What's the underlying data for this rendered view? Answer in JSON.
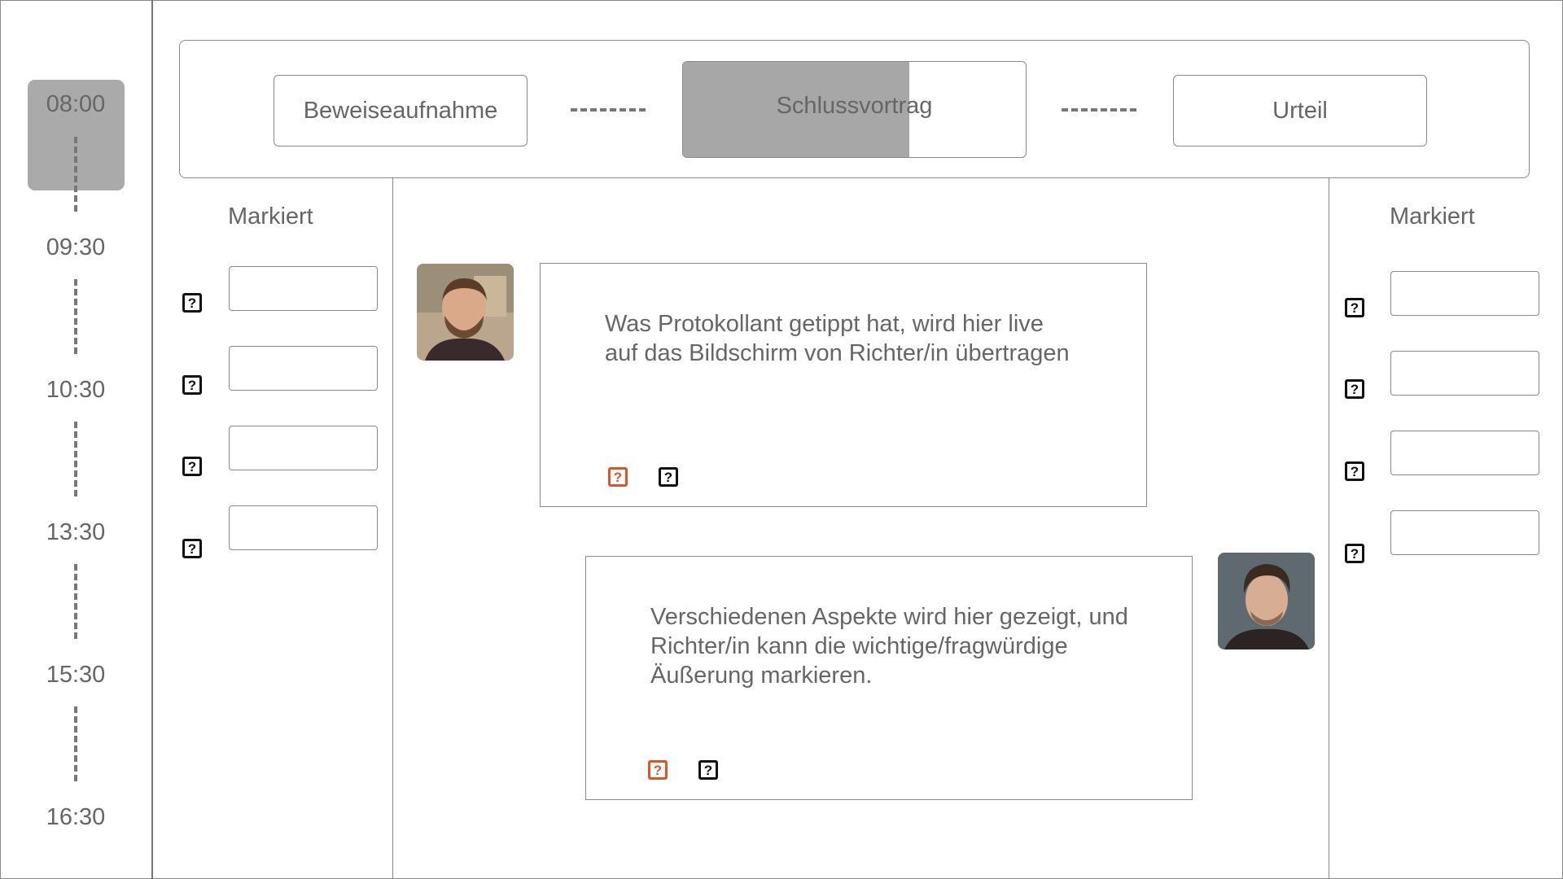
{
  "timeline": {
    "times": [
      "08:00",
      "09:30",
      "10:30",
      "13:30",
      "15:30",
      "16:30"
    ],
    "active_index": 0
  },
  "stepper": {
    "steps": [
      "Beweiseaufnahme",
      "Schlussvortrag",
      "Urteil"
    ],
    "active_index": 1,
    "active_progress": 0.66
  },
  "left_panel": {
    "title": "Markiert"
  },
  "right_panel": {
    "title": "Markiert"
  },
  "messages": [
    {
      "text": "Was Protokollant getippt hat, wird hier live\nauf das Bildschirm von Richter/in übertragen",
      "icons": [
        "question-icon-orange",
        "question-icon"
      ]
    },
    {
      "text": "Verschiedenen Aspekte wird hier gezeigt, und\nRichter/in kann die wichtige/fragwürdige\nÄußerung markieren.",
      "icons": [
        "question-icon-orange",
        "question-icon"
      ]
    }
  ],
  "icon_glyph": "?",
  "colors": {
    "active_gray": "#a7a7a7",
    "accent_orange": "#d9552a",
    "line_gray": "#888888"
  }
}
